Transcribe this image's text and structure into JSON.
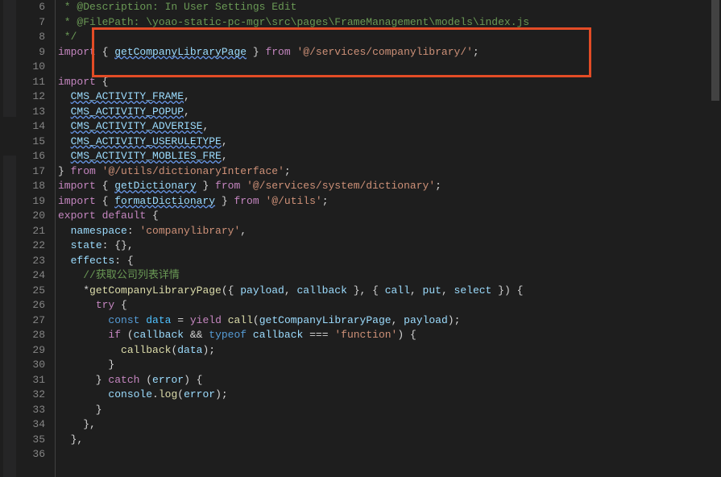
{
  "lineStart": 6,
  "lines": [
    {
      "n": 6,
      "segs": [
        {
          "t": " * ",
          "c": "c-comment"
        },
        {
          "t": "@Description",
          "c": "c-comment"
        },
        {
          "t": ": In User Settings Edit",
          "c": "c-comment"
        }
      ]
    },
    {
      "n": 7,
      "segs": [
        {
          "t": " * ",
          "c": "c-comment"
        },
        {
          "t": "@FilePath",
          "c": "c-comment"
        },
        {
          "t": ": \\yoao-static-pc-mgr\\src\\pages\\FrameManagement\\models\\index.js",
          "c": "c-comment"
        }
      ]
    },
    {
      "n": 8,
      "segs": [
        {
          "t": " */",
          "c": "c-comment"
        }
      ]
    },
    {
      "n": 9,
      "segs": [
        {
          "t": "import",
          "c": "c-keyword"
        },
        {
          "t": " { ",
          "c": "c-punc"
        },
        {
          "t": "getCompanyLibraryPage",
          "c": "c-var squiggle"
        },
        {
          "t": " } ",
          "c": "c-punc"
        },
        {
          "t": "from",
          "c": "c-keyword"
        },
        {
          "t": " ",
          "c": ""
        },
        {
          "t": "'@/services/companylibrary/'",
          "c": "c-string"
        },
        {
          "t": ";",
          "c": "c-punc"
        }
      ]
    },
    {
      "n": 10,
      "segs": []
    },
    {
      "n": 11,
      "segs": [
        {
          "t": "import",
          "c": "c-keyword"
        },
        {
          "t": " {",
          "c": "c-punc"
        }
      ]
    },
    {
      "n": 12,
      "segs": [
        {
          "t": "  ",
          "c": ""
        },
        {
          "t": "CMS_ACTIVITY_FRAME",
          "c": "c-var squiggle"
        },
        {
          "t": ",",
          "c": "c-punc"
        }
      ]
    },
    {
      "n": 13,
      "segs": [
        {
          "t": "  ",
          "c": ""
        },
        {
          "t": "CMS_ACTIVITY_POPUP",
          "c": "c-var squiggle"
        },
        {
          "t": ",",
          "c": "c-punc"
        }
      ]
    },
    {
      "n": 14,
      "segs": [
        {
          "t": "  ",
          "c": ""
        },
        {
          "t": "CMS_ACTIVITY_ADVERISE",
          "c": "c-var squiggle"
        },
        {
          "t": ",",
          "c": "c-punc"
        }
      ]
    },
    {
      "n": 15,
      "segs": [
        {
          "t": "  ",
          "c": ""
        },
        {
          "t": "CMS_ACTIVITY_USERULETYPE",
          "c": "c-var squiggle"
        },
        {
          "t": ",",
          "c": "c-punc"
        }
      ]
    },
    {
      "n": 16,
      "segs": [
        {
          "t": "  ",
          "c": ""
        },
        {
          "t": "CMS_ACTIVITY_MOBLIES_FRE",
          "c": "c-var squiggle"
        },
        {
          "t": ",",
          "c": "c-punc"
        }
      ]
    },
    {
      "n": 17,
      "segs": [
        {
          "t": "} ",
          "c": "c-punc"
        },
        {
          "t": "from",
          "c": "c-keyword"
        },
        {
          "t": " ",
          "c": ""
        },
        {
          "t": "'@/utils/dictionaryInterface'",
          "c": "c-string"
        },
        {
          "t": ";",
          "c": "c-punc"
        }
      ]
    },
    {
      "n": 18,
      "segs": [
        {
          "t": "import",
          "c": "c-keyword"
        },
        {
          "t": " { ",
          "c": "c-punc"
        },
        {
          "t": "getDictionary",
          "c": "c-var squiggle"
        },
        {
          "t": " } ",
          "c": "c-punc"
        },
        {
          "t": "from",
          "c": "c-keyword"
        },
        {
          "t": " ",
          "c": ""
        },
        {
          "t": "'@/services/system/dictionary'",
          "c": "c-string"
        },
        {
          "t": ";",
          "c": "c-punc"
        }
      ]
    },
    {
      "n": 19,
      "segs": [
        {
          "t": "import",
          "c": "c-keyword"
        },
        {
          "t": " { ",
          "c": "c-punc"
        },
        {
          "t": "formatDictionary",
          "c": "c-var squiggle"
        },
        {
          "t": " } ",
          "c": "c-punc"
        },
        {
          "t": "from",
          "c": "c-keyword"
        },
        {
          "t": " ",
          "c": ""
        },
        {
          "t": "'@/utils'",
          "c": "c-string"
        },
        {
          "t": ";",
          "c": "c-punc"
        }
      ]
    },
    {
      "n": 20,
      "segs": [
        {
          "t": "export",
          "c": "c-keyword"
        },
        {
          "t": " ",
          "c": ""
        },
        {
          "t": "default",
          "c": "c-keyword"
        },
        {
          "t": " {",
          "c": "c-punc"
        }
      ]
    },
    {
      "n": 21,
      "segs": [
        {
          "t": "  ",
          "c": ""
        },
        {
          "t": "namespace",
          "c": "c-prop"
        },
        {
          "t": ": ",
          "c": ""
        },
        {
          "t": "'companylibrary'",
          "c": "c-string"
        },
        {
          "t": ",",
          "c": "c-punc"
        }
      ]
    },
    {
      "n": 22,
      "segs": [
        {
          "t": "  ",
          "c": ""
        },
        {
          "t": "state",
          "c": "c-prop"
        },
        {
          "t": ": {},",
          "c": "c-punc"
        }
      ]
    },
    {
      "n": 23,
      "segs": [
        {
          "t": "  ",
          "c": ""
        },
        {
          "t": "effects",
          "c": "c-prop"
        },
        {
          "t": ": {",
          "c": "c-punc"
        }
      ]
    },
    {
      "n": 24,
      "segs": [
        {
          "t": "    ",
          "c": ""
        },
        {
          "t": "//获取公司列表详情",
          "c": "c-comment"
        }
      ]
    },
    {
      "n": 25,
      "segs": [
        {
          "t": "    *",
          "c": "c-punc"
        },
        {
          "t": "getCompanyLibraryPage",
          "c": "c-func"
        },
        {
          "t": "({ ",
          "c": "c-punc"
        },
        {
          "t": "payload",
          "c": "c-var"
        },
        {
          "t": ", ",
          "c": "c-punc"
        },
        {
          "t": "callback",
          "c": "c-var"
        },
        {
          "t": " }, { ",
          "c": "c-punc"
        },
        {
          "t": "call",
          "c": "c-var"
        },
        {
          "t": ", ",
          "c": "c-punc"
        },
        {
          "t": "put",
          "c": "c-var"
        },
        {
          "t": ", ",
          "c": "c-punc"
        },
        {
          "t": "select",
          "c": "c-var"
        },
        {
          "t": " }) {",
          "c": "c-punc"
        }
      ]
    },
    {
      "n": 26,
      "segs": [
        {
          "t": "      ",
          "c": ""
        },
        {
          "t": "try",
          "c": "c-keyword"
        },
        {
          "t": " {",
          "c": "c-punc"
        }
      ]
    },
    {
      "n": 27,
      "segs": [
        {
          "t": "        ",
          "c": ""
        },
        {
          "t": "const",
          "c": "c-keyword2"
        },
        {
          "t": " ",
          "c": ""
        },
        {
          "t": "data",
          "c": "c-const"
        },
        {
          "t": " = ",
          "c": "c-punc"
        },
        {
          "t": "yield",
          "c": "c-keyword"
        },
        {
          "t": " ",
          "c": ""
        },
        {
          "t": "call",
          "c": "c-func"
        },
        {
          "t": "(",
          "c": "c-punc"
        },
        {
          "t": "getCompanyLibraryPage",
          "c": "c-var"
        },
        {
          "t": ", ",
          "c": "c-punc"
        },
        {
          "t": "payload",
          "c": "c-var"
        },
        {
          "t": ");",
          "c": "c-punc"
        }
      ]
    },
    {
      "n": 28,
      "segs": [
        {
          "t": "        ",
          "c": ""
        },
        {
          "t": "if",
          "c": "c-keyword"
        },
        {
          "t": " (",
          "c": "c-punc"
        },
        {
          "t": "callback",
          "c": "c-var"
        },
        {
          "t": " && ",
          "c": "c-punc"
        },
        {
          "t": "typeof",
          "c": "c-keyword2"
        },
        {
          "t": " ",
          "c": ""
        },
        {
          "t": "callback",
          "c": "c-var"
        },
        {
          "t": " === ",
          "c": "c-punc"
        },
        {
          "t": "'function'",
          "c": "c-string"
        },
        {
          "t": ") {",
          "c": "c-punc"
        }
      ]
    },
    {
      "n": 29,
      "segs": [
        {
          "t": "          ",
          "c": ""
        },
        {
          "t": "callback",
          "c": "c-func"
        },
        {
          "t": "(",
          "c": "c-punc"
        },
        {
          "t": "data",
          "c": "c-var"
        },
        {
          "t": ");",
          "c": "c-punc"
        }
      ]
    },
    {
      "n": 30,
      "segs": [
        {
          "t": "        }",
          "c": "c-punc"
        }
      ]
    },
    {
      "n": 31,
      "segs": [
        {
          "t": "      } ",
          "c": "c-punc"
        },
        {
          "t": "catch",
          "c": "c-keyword"
        },
        {
          "t": " (",
          "c": "c-punc"
        },
        {
          "t": "error",
          "c": "c-var"
        },
        {
          "t": ") {",
          "c": "c-punc"
        }
      ]
    },
    {
      "n": 32,
      "segs": [
        {
          "t": "        ",
          "c": ""
        },
        {
          "t": "console",
          "c": "c-var"
        },
        {
          "t": ".",
          "c": "c-punc"
        },
        {
          "t": "log",
          "c": "c-func"
        },
        {
          "t": "(",
          "c": "c-punc"
        },
        {
          "t": "error",
          "c": "c-var"
        },
        {
          "t": ");",
          "c": "c-punc"
        }
      ]
    },
    {
      "n": 33,
      "segs": [
        {
          "t": "      }",
          "c": "c-punc"
        }
      ]
    },
    {
      "n": 34,
      "segs": [
        {
          "t": "    },",
          "c": "c-punc"
        }
      ]
    },
    {
      "n": 35,
      "segs": [
        {
          "t": "  },",
          "c": "c-punc"
        }
      ]
    },
    {
      "n": 36,
      "segs": []
    }
  ]
}
